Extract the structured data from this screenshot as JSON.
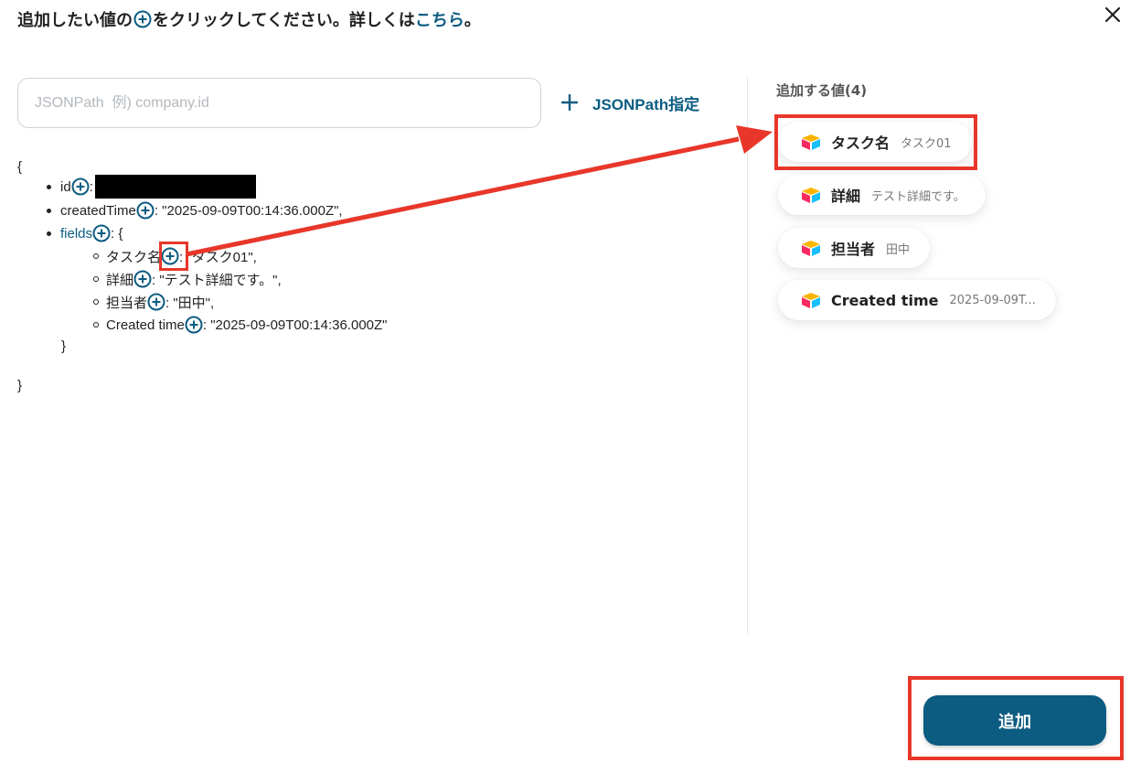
{
  "header": {
    "title_before": "追加したい値の",
    "title_after": "をクリックしてください。詳しくは",
    "title_link": "こちら",
    "title_end": "。"
  },
  "search": {
    "placeholder": "JSONPath  例) company.id"
  },
  "jsonpath_button": {
    "label": "JSONPath指定"
  },
  "tree": {
    "open_brace": "{",
    "close_brace": "}",
    "inner_close": "}",
    "id": {
      "key": "id",
      "sep": ":"
    },
    "created_time": {
      "key": "createdTime",
      "value": ": \"2025-09-09T00:14:36.000Z\","
    },
    "fields": {
      "key": "fields",
      "value": ": {"
    },
    "task_name": {
      "key": "タスク名",
      "value": ": \"タスク01\","
    },
    "detail": {
      "key": "詳細",
      "value": ": \"テスト詳細です。\","
    },
    "assignee": {
      "key": "担当者",
      "value": ": \"田中\","
    },
    "created_time_field": {
      "key": "Created time",
      "value": ": \"2025-09-09T00:14:36.000Z\""
    }
  },
  "panel": {
    "title": "追加する値(4)",
    "chips": [
      {
        "name": "タスク名",
        "value": "タスク01"
      },
      {
        "name": "詳細",
        "value": "テスト詳細です。"
      },
      {
        "name": "担当者",
        "value": "田中"
      },
      {
        "name": "Created time",
        "value": "2025-09-09T..."
      }
    ]
  },
  "footer": {
    "add_label": "追加"
  },
  "colors": {
    "accent": "#0c5c82",
    "highlight": "#e8372a"
  },
  "icons": {
    "close": "close-icon",
    "add": "add-circle-icon",
    "plus": "plus-icon",
    "app_logo": "airtable-logo-icon"
  }
}
